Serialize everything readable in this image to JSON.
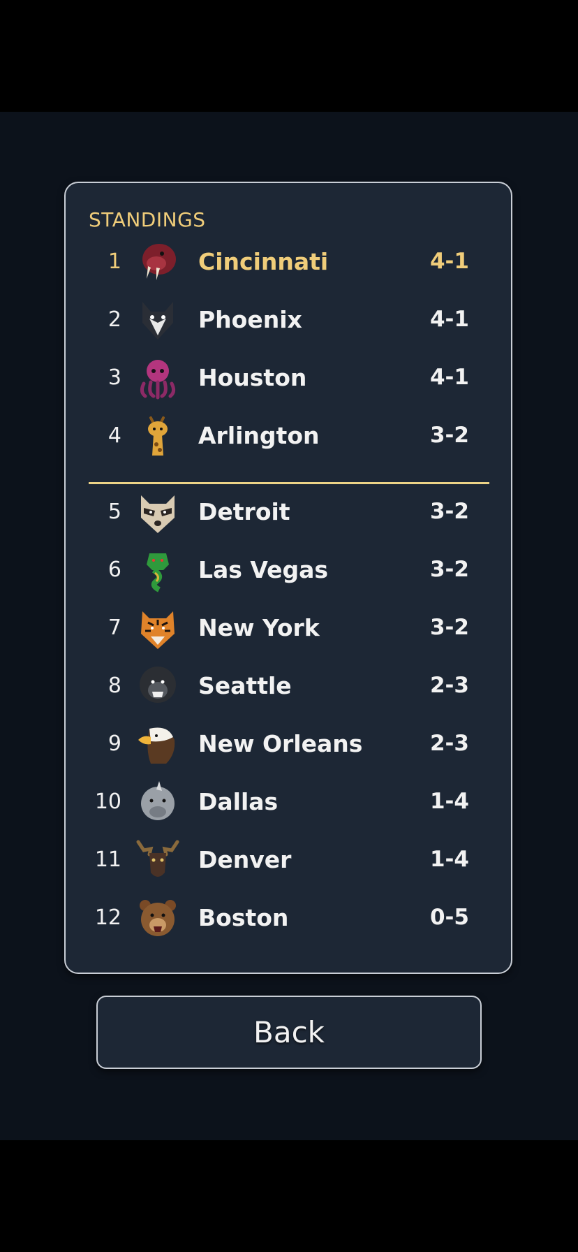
{
  "panel": {
    "title": "STANDINGS"
  },
  "standings": [
    {
      "rank": "1",
      "team": "Cincinnati",
      "record": "4-1",
      "icon": "walrus-icon"
    },
    {
      "rank": "2",
      "team": "Phoenix",
      "record": "4-1",
      "icon": "wolf-icon"
    },
    {
      "rank": "3",
      "team": "Houston",
      "record": "4-1",
      "icon": "octopus-icon"
    },
    {
      "rank": "4",
      "team": "Arlington",
      "record": "3-2",
      "icon": "giraffe-icon"
    },
    {
      "rank": "5",
      "team": "Detroit",
      "record": "3-2",
      "icon": "raccoon-icon"
    },
    {
      "rank": "6",
      "team": "Las Vegas",
      "record": "3-2",
      "icon": "cobra-icon"
    },
    {
      "rank": "7",
      "team": "New York",
      "record": "3-2",
      "icon": "tiger-icon"
    },
    {
      "rank": "8",
      "team": "Seattle",
      "record": "2-3",
      "icon": "gorilla-icon"
    },
    {
      "rank": "9",
      "team": "New Orleans",
      "record": "2-3",
      "icon": "eagle-icon"
    },
    {
      "rank": "10",
      "team": "Dallas",
      "record": "1-4",
      "icon": "rhino-icon"
    },
    {
      "rank": "11",
      "team": "Denver",
      "record": "1-4",
      "icon": "moose-icon"
    },
    {
      "rank": "12",
      "team": "Boston",
      "record": "0-5",
      "icon": "bear-icon"
    }
  ],
  "back_button": {
    "label": "Back"
  },
  "colors": {
    "accent": "#f0cd7a",
    "panel": "#1d2735",
    "background": "#0c121b",
    "text": "#f2f2f2"
  }
}
